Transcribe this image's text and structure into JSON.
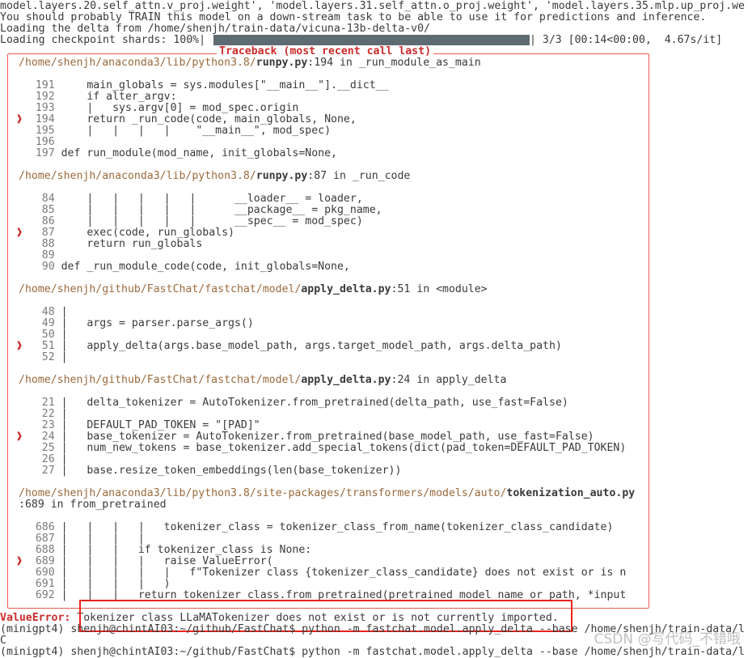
{
  "header": {
    "line1": "model.layers.20.self_attn.v_proj.weight', 'model.layers.31.self_attn.o_proj.weight', 'model.layers.35.mlp.up_proj.we",
    "line2": "You should probably TRAIN this model on a down-stream task to be able to use it for predictions and inference.",
    "line3": "Loading the delta from /home/shenjh/train-data/vicuna-13b-delta-v0/",
    "progress_label": "Loading checkpoint shards: 100%|",
    "progress_tail": "| 3/3 [00:14<00:00,  4.67s/it]",
    "progress_fraction": 1.0
  },
  "traceback": {
    "title": "Traceback (most recent call last)",
    "frames": [
      {
        "path": "/home/shenjh/anaconda3/lib/python3.8/",
        "file": "runpy.py",
        "loc": ":194 in _run_module_as_main",
        "lines": [
          {
            "no": "191",
            "mark": "",
            "code": "    main_globals = sys.modules[\"__main__\"].__dict__"
          },
          {
            "no": "192",
            "mark": "",
            "code": "    if alter_argv:"
          },
          {
            "no": "193",
            "mark": "",
            "code": "    |   sys.argv[0] = mod_spec.origin"
          },
          {
            "no": "194",
            "mark": "❱",
            "code": "    return _run_code(code, main_globals, None,"
          },
          {
            "no": "195",
            "mark": "",
            "code": "    |   |   |   |    \"__main__\", mod_spec)"
          },
          {
            "no": "196",
            "mark": "",
            "code": ""
          },
          {
            "no": "197",
            "mark": "",
            "code": "def run_module(mod_name, init_globals=None,"
          }
        ]
      },
      {
        "path": "/home/shenjh/anaconda3/lib/python3.8/",
        "file": "runpy.py",
        "loc": ":87 in _run_code",
        "lines": [
          {
            "no": "84",
            "mark": "",
            "code": "    |   |   |   |   |      __loader__ = loader,"
          },
          {
            "no": "85",
            "mark": "",
            "code": "    |   |   |   |   |      __package__ = pkg_name,"
          },
          {
            "no": "86",
            "mark": "",
            "code": "    |   |   |   |   |      __spec__ = mod_spec)"
          },
          {
            "no": "87",
            "mark": "❱",
            "code": "    exec(code, run_globals)"
          },
          {
            "no": "88",
            "mark": "",
            "code": "    return run_globals"
          },
          {
            "no": "89",
            "mark": "",
            "code": ""
          },
          {
            "no": "90",
            "mark": "",
            "code": "def _run_module_code(code, init_globals=None,"
          }
        ]
      },
      {
        "path": "/home/shenjh/github/FastChat/fastchat/model/",
        "file": "apply_delta.py",
        "loc": ":51 in <module>",
        "lines": [
          {
            "no": "48",
            "mark": "",
            "code": "|"
          },
          {
            "no": "49",
            "mark": "",
            "code": "|   args = parser.parse_args()"
          },
          {
            "no": "50",
            "mark": "",
            "code": "|"
          },
          {
            "no": "51",
            "mark": "❱",
            "code": "|   apply_delta(args.base_model_path, args.target_model_path, args.delta_path)"
          },
          {
            "no": "52",
            "mark": "",
            "code": "|"
          }
        ]
      },
      {
        "path": "/home/shenjh/github/FastChat/fastchat/model/",
        "file": "apply_delta.py",
        "loc": ":24 in apply_delta",
        "lines": [
          {
            "no": "21",
            "mark": "",
            "code": "|   delta_tokenizer = AutoTokenizer.from_pretrained(delta_path, use_fast=False)"
          },
          {
            "no": "22",
            "mark": "",
            "code": "|"
          },
          {
            "no": "23",
            "mark": "",
            "code": "|   DEFAULT_PAD_TOKEN = \"[PAD]\""
          },
          {
            "no": "24",
            "mark": "❱",
            "code": "|   base_tokenizer = AutoTokenizer.from_pretrained(base_model_path, use_fast=False)"
          },
          {
            "no": "25",
            "mark": "",
            "code": "|   num_new_tokens = base_tokenizer.add_special_tokens(dict(pad_token=DEFAULT_PAD_TOKEN)"
          },
          {
            "no": "26",
            "mark": "",
            "code": "|"
          },
          {
            "no": "27",
            "mark": "",
            "code": "|   base.resize_token_embeddings(len(base_tokenizer))"
          }
        ]
      },
      {
        "path": "/home/shenjh/anaconda3/lib/python3.8/site-packages/transformers/models/auto/",
        "file": "tokenization_auto.py",
        "loc": ":689 in from_pretrained",
        "lines": [
          {
            "no": "686",
            "mark": "",
            "code": "|   |   |   |   tokenizer_class = tokenizer_class_from_name(tokenizer_class_candidate)"
          },
          {
            "no": "687",
            "mark": "",
            "code": "|   |   |   |"
          },
          {
            "no": "688",
            "mark": "",
            "code": "|   |   |   if tokenizer_class is None:"
          },
          {
            "no": "689",
            "mark": "❱",
            "code": "|   |   |   |   raise ValueError("
          },
          {
            "no": "690",
            "mark": "",
            "code": "|   |   |   |   |   f\"Tokenizer class {tokenizer_class_candidate} does not exist or is n"
          },
          {
            "no": "691",
            "mark": "",
            "code": "|   |   |   |   )"
          },
          {
            "no": "692",
            "mark": "",
            "code": "|   |   |   return tokenizer_class.from_pretrained(pretrained_model_name_or_path, *input"
          }
        ]
      }
    ]
  },
  "error": {
    "name": "ValueError:",
    "message": " Tokenizer class LLaMATokenizer does not exist or is not currently imported."
  },
  "footer": {
    "cmd1": "(minigpt4) shenjh@chintAI03:~/github/FastChat$ python -m fastchat.model.apply_delta --base /home/shenjh/train-data/l",
    "c_line": "C",
    "cmd2": "(minigpt4) shenjh@chintAI03:~/github/FastChat$ python -m fastchat.model.apply_delta --base /home/shenjh/train-data/l"
  },
  "watermark": "CSDN @写代码_不错哦",
  "colors": {
    "accent_border": "#e85b4f",
    "highlight_red": "#e8231c",
    "progress_fill": "#5f6b73",
    "path_color": "#9a6a3c"
  }
}
